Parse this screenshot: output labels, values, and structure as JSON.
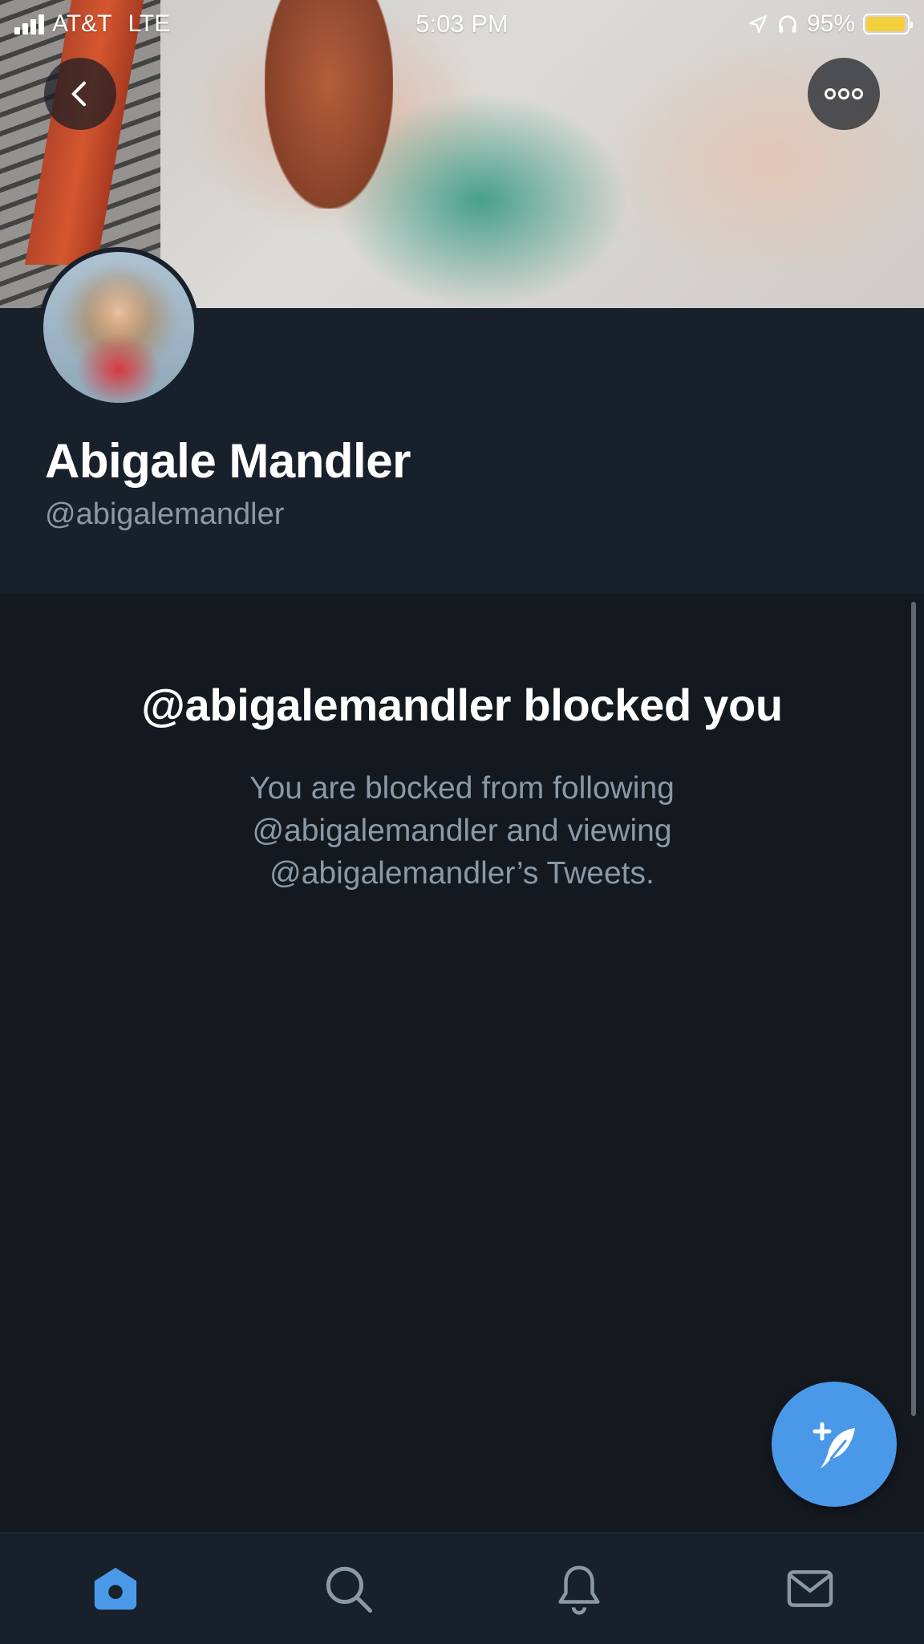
{
  "status_bar": {
    "carrier": "AT&T",
    "network": "LTE",
    "time": "5:03 PM",
    "battery_percent": "95%",
    "battery_level": 0.95,
    "battery_color": "#f5cf3c"
  },
  "profile": {
    "display_name": "Abigale Mandler",
    "handle": "@abigalemandler"
  },
  "blocked": {
    "title": "@abigalemandler blocked you",
    "message_line1": "You are blocked from following",
    "message_line2": "@abigalemandler and viewing",
    "message_line3": "@abigalemandler’s Tweets."
  },
  "tabs": [
    {
      "name": "home",
      "icon": "home-icon",
      "active": true
    },
    {
      "name": "search",
      "icon": "search-icon",
      "active": false
    },
    {
      "name": "notifications",
      "icon": "bell-icon",
      "active": false
    },
    {
      "name": "messages",
      "icon": "mail-icon",
      "active": false
    }
  ],
  "colors": {
    "accent": "#4a99e9",
    "background": "#141920",
    "surface": "#18202b",
    "secondary_text": "#8b98a6"
  }
}
